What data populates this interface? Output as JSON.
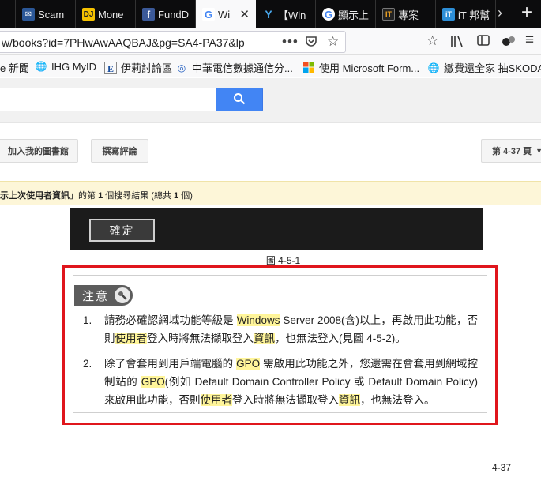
{
  "tabs": [
    {
      "label": "Scam",
      "icon": "scam-favicon-icon"
    },
    {
      "label": "Mone",
      "icon": "dj-favicon-icon"
    },
    {
      "label": "FundD",
      "icon": "facebook-icon"
    },
    {
      "label": "Wi",
      "icon": "google-icon"
    },
    {
      "label": "【Win",
      "icon": "wrench-favicon-icon"
    },
    {
      "label": "顯示上",
      "icon": "google-icon"
    },
    {
      "label": "專案",
      "icon": "ithome-icon"
    },
    {
      "label": "iT 邦幫",
      "icon": "ithelp-icon"
    }
  ],
  "url": {
    "visible": "w/books?id=7PHwAwAAQBAJ&pg=SA4-PA37&lp"
  },
  "bookmarks": [
    {
      "label": "e 新聞"
    },
    {
      "label": "IHG MyID"
    },
    {
      "label": "伊莉討論區"
    },
    {
      "label": "中華電信數據通信分..."
    },
    {
      "label": "使用 Microsoft Form..."
    },
    {
      "label": "繳費還全家 抽SKODA..."
    }
  ],
  "buttons": {
    "add_library": "加入我的圖書館",
    "write_review": "撰寫評論",
    "page_selector": "第 4-37 頁"
  },
  "result_bar": {
    "query_part": "示上次使用者資訊",
    "text_a": "」的第",
    "count_a": "1",
    "text_b": "個搜尋結果 (總共",
    "count_b": "1",
    "text_c": "個)"
  },
  "book": {
    "confirm_button": "確定",
    "figure_caption": "圖 4-5-1",
    "note_label": "注意",
    "items": [
      {
        "num": "1.",
        "segments": [
          {
            "t": "請務必確認網域功能等級是 "
          },
          {
            "t": "Windows",
            "hl": true
          },
          {
            "t": " Server 2008(含)以上，再啟用此功能，否則"
          },
          {
            "t": "使用者",
            "hl": true
          },
          {
            "t": "登入時將無法擷取登入"
          },
          {
            "t": "資訊",
            "hl": true
          },
          {
            "t": "，也無法登入(見圖 4-5-2)。"
          }
        ]
      },
      {
        "num": "2.",
        "segments": [
          {
            "t": "除了會套用到用戶端電腦的 "
          },
          {
            "t": "GPO",
            "hl": true
          },
          {
            "t": " 需啟用此功能之外，您還需在會套用到網域控制站的 "
          },
          {
            "t": "GPO",
            "hl": true
          },
          {
            "t": "(例如 Default Domain Controller Policy 或 Default Domain Policy)來啟用此功能，否則"
          },
          {
            "t": "使用者",
            "hl": true
          },
          {
            "t": "登入時將無法擷取登入"
          },
          {
            "t": "資訊",
            "hl": true
          },
          {
            "t": "，也無法登入。"
          }
        ]
      }
    ],
    "page_number": "4-37"
  }
}
